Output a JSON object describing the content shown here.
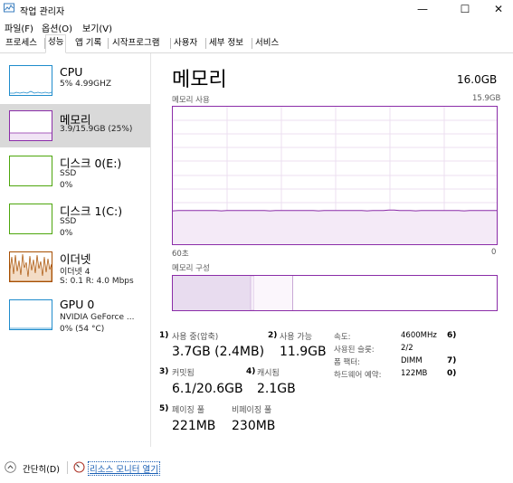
{
  "window": {
    "title": "작업 관리자",
    "minimize": "—",
    "maximize": "☐",
    "close": "✕"
  },
  "menubar": [
    "파일(F)",
    "옵션(O)",
    "보기(V)"
  ],
  "tabs": [
    "프로세스",
    "성능",
    "앱 기록",
    "시작프로그램",
    "사용자",
    "세부 정보",
    "서비스"
  ],
  "sidebar": {
    "items": [
      {
        "title": "CPU",
        "line1": "5%  4.99GHZ",
        "line2": ""
      },
      {
        "title": "메모리",
        "line1": "3.9/15.9GB (25%)",
        "line2": ""
      },
      {
        "title": "디스크 0(E:)",
        "line1": "SSD",
        "line2": "0%"
      },
      {
        "title": "디스크 1(C:)",
        "line1": "SSD",
        "line2": "0%"
      },
      {
        "title": "이더넷",
        "line1": "이더넷 4",
        "line2": "S: 0.1  R: 4.0 Mbps"
      },
      {
        "title": "GPU 0",
        "line1": "NVIDIA GeForce ...",
        "line2": "0%  (54 °C)"
      }
    ]
  },
  "main": {
    "title": "메모리",
    "total": "16.0GB",
    "graph_label": "메모리 사용",
    "graph_max": "15.9GB",
    "axis_left": "60초",
    "axis_right": "0",
    "composition_label": "메모리 구성",
    "usage_fraction": 0.245,
    "stats": {
      "in_use_label": "사용 중(압축)",
      "in_use_value": "3.7GB (2.4MB)",
      "in_use_marker": "1)",
      "available_label": "사용 가능",
      "available_value": "11.9GB",
      "available_marker": "2)",
      "committed_label": "커밋됨",
      "committed_value": "6.1/20.6GB",
      "committed_marker": "3)",
      "cached_label": "캐시됨",
      "cached_value": "2.1GB",
      "cached_marker": "4)",
      "paged_label": "페이징 풀",
      "paged_value": "221MB",
      "paged_marker": "5)",
      "nonpaged_label": "비페이징 풀",
      "nonpaged_value": "230MB"
    },
    "details": [
      {
        "label": "속도:",
        "value": "4600MHz",
        "marker": "6)"
      },
      {
        "label": "사용된 슬롯:",
        "value": "2/2",
        "marker": ""
      },
      {
        "label": "폼 팩터:",
        "value": "DIMM",
        "marker": "7)"
      },
      {
        "label": "하드웨어 예약:",
        "value": "122MB",
        "marker": "0)"
      }
    ]
  },
  "bottom": {
    "fewer_details": "간단히(D)",
    "resource_monitor": "리소스 모니터 열기"
  },
  "colors": {
    "memory_accent": "#8b2da8",
    "cpu": "#1f8ccc",
    "disk": "#4da60c",
    "ethernet": "#a74f01"
  }
}
